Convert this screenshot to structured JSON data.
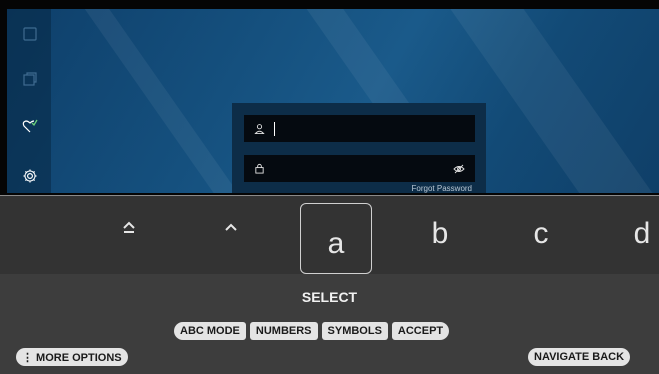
{
  "sidebar": {
    "icons": [
      "square-icon",
      "copy-icon",
      "heart-check-icon",
      "gear-icon"
    ]
  },
  "login": {
    "username_value": "",
    "password_value": "",
    "forgot_label": "Forgot Password"
  },
  "keyboard": {
    "shift_icon": "shift-up-icon",
    "up_icon": "chevron-up-icon",
    "selected_key": "a",
    "keys": [
      "b",
      "c",
      "d"
    ],
    "select_label": "SELECT",
    "modes": [
      "ABC MODE",
      "NUMBERS",
      "SYMBOLS",
      "ACCEPT"
    ],
    "more_options": "⋮ MORE OPTIONS",
    "navigate_back": "NAVIGATE BACK"
  }
}
